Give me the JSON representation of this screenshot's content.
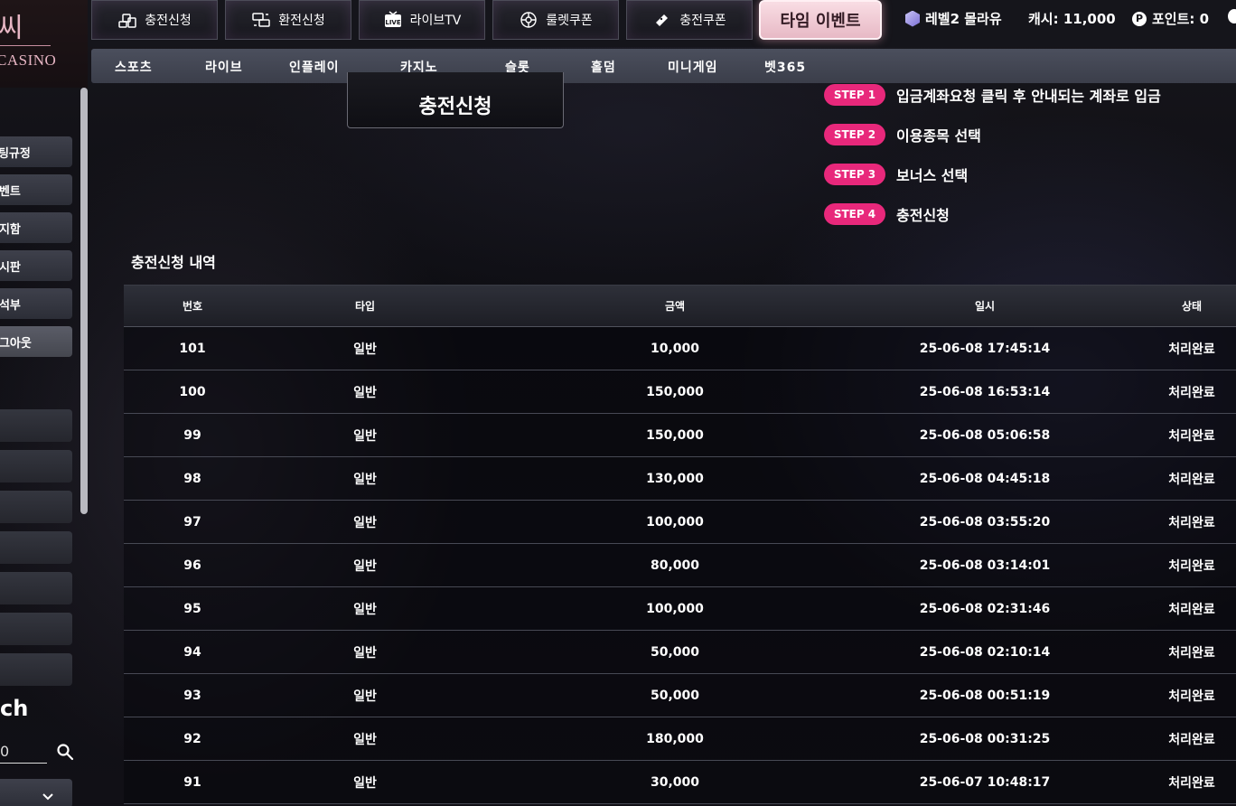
{
  "logo": {
    "korean": "씨",
    "english": "CASINO"
  },
  "topbar": {
    "buttons": [
      {
        "label": "충전신청",
        "icon": "coins-icon"
      },
      {
        "label": "환전신청",
        "icon": "exchange-icon"
      },
      {
        "label": "라이브TV",
        "icon": "live-tv-icon"
      },
      {
        "label": "룰렛쿠폰",
        "icon": "roulette-icon"
      },
      {
        "label": "충전쿠폰",
        "icon": "ticket-icon"
      }
    ],
    "time_event": "타임 이벤트",
    "level": "레벨2 몰라유",
    "cash": "캐시: 11,000",
    "points": "포인트: 0"
  },
  "nav": {
    "items": [
      "스포츠",
      "라이브",
      "인플레이",
      "카지노",
      "슬롯",
      "홀덤",
      "미니게임",
      "벳365"
    ]
  },
  "sidebar": {
    "items": [
      "베팅규정",
      "이벤트",
      "쪽지함",
      "게시판",
      "출석부",
      "로그아웃"
    ],
    "search_title": "ch",
    "search_value": "0"
  },
  "main": {
    "deposit_button": "충전신청",
    "steps": [
      {
        "badge": "STEP 1",
        "text": "입금계좌요청 클릭 후 안내되는 계좌로 입금"
      },
      {
        "badge": "STEP 2",
        "text": "이용종목 선택"
      },
      {
        "badge": "STEP 3",
        "text": "보너스 선택"
      },
      {
        "badge": "STEP 4",
        "text": "충전신청"
      }
    ],
    "section_title": "충전신청 내역",
    "table": {
      "headers": [
        "번호",
        "타입",
        "금액",
        "일시",
        "상태"
      ],
      "rows": [
        [
          "101",
          "일반",
          "10,000",
          "25-06-08 17:45:14",
          "처리완료"
        ],
        [
          "100",
          "일반",
          "150,000",
          "25-06-08 16:53:14",
          "처리완료"
        ],
        [
          "99",
          "일반",
          "150,000",
          "25-06-08 05:06:58",
          "처리완료"
        ],
        [
          "98",
          "일반",
          "130,000",
          "25-06-08 04:45:18",
          "처리완료"
        ],
        [
          "97",
          "일반",
          "100,000",
          "25-06-08 03:55:20",
          "처리완료"
        ],
        [
          "96",
          "일반",
          "80,000",
          "25-06-08 03:14:01",
          "처리완료"
        ],
        [
          "95",
          "일반",
          "100,000",
          "25-06-08 02:31:46",
          "처리완료"
        ],
        [
          "94",
          "일반",
          "50,000",
          "25-06-08 02:10:14",
          "처리완료"
        ],
        [
          "93",
          "일반",
          "50,000",
          "25-06-08 00:51:19",
          "처리완료"
        ],
        [
          "92",
          "일반",
          "180,000",
          "25-06-08 00:31:25",
          "처리완료"
        ],
        [
          "91",
          "일반",
          "30,000",
          "25-06-07 10:48:17",
          "처리완료"
        ]
      ]
    }
  },
  "colors": {
    "accent": "#e8287b",
    "event_bg": "#f3cdd7",
    "nav_bg": "#454856"
  }
}
